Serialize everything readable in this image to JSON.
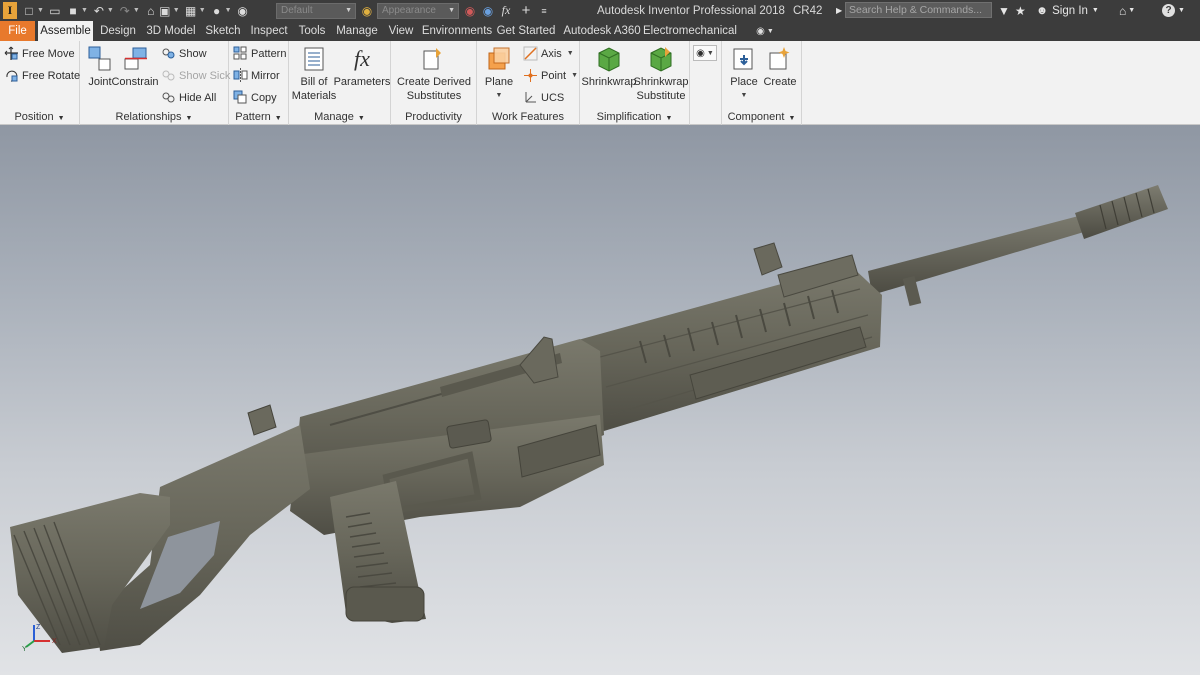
{
  "window": {
    "title": "Autodesk Inventor Professional 2018",
    "build": "CR42",
    "search_placeholder": "Search Help & Commands...",
    "sign_in": "Sign In"
  },
  "quick_access": {
    "combo_1": "Default",
    "combo_2": "Appearance"
  },
  "tabs": [
    {
      "label": "File"
    },
    {
      "label": "Assemble"
    },
    {
      "label": "Design"
    },
    {
      "label": "3D Model"
    },
    {
      "label": "Sketch"
    },
    {
      "label": "Inspect"
    },
    {
      "label": "Tools"
    },
    {
      "label": "Manage"
    },
    {
      "label": "View"
    },
    {
      "label": "Environments"
    },
    {
      "label": "Get Started"
    },
    {
      "label": "Autodesk A360"
    },
    {
      "label": "Electromechanical"
    }
  ],
  "ribbon": {
    "position": {
      "title": "Position",
      "free_move": "Free Move",
      "free_rotate": "Free Rotate"
    },
    "relationships": {
      "title": "Relationships",
      "joint": "Joint",
      "constrain": "Constrain",
      "show": "Show",
      "show_sick": "Show Sick",
      "hide_all": "Hide All"
    },
    "pattern": {
      "title": "Pattern",
      "pattern": "Pattern",
      "mirror": "Mirror",
      "copy": "Copy"
    },
    "manage": {
      "title": "Manage",
      "bom_line1": "Bill of",
      "bom_line2": "Materials",
      "parameters": "Parameters"
    },
    "productivity": {
      "title": "Productivity",
      "line1": "Create Derived",
      "line2": "Substitutes"
    },
    "work_features": {
      "title": "Work Features",
      "plane": "Plane",
      "axis": "Axis",
      "point": "Point",
      "ucs": "UCS"
    },
    "simplification": {
      "title": "Simplification",
      "shrinkwrap": "Shrinkwrap",
      "shrinkwrap_sub_line1": "Shrinkwrap",
      "shrinkwrap_sub_line2": "Substitute"
    },
    "component": {
      "title": "Component",
      "place": "Place",
      "create": "Create"
    }
  },
  "viewport": {
    "model_color": "#6b6a5e",
    "triad": {
      "x": "X",
      "y": "Y",
      "z": "Z"
    }
  },
  "colors": {
    "file_tab": "#e8792c",
    "titlebar": "#3c3c3c",
    "ribbon": "#f2f2f2"
  }
}
